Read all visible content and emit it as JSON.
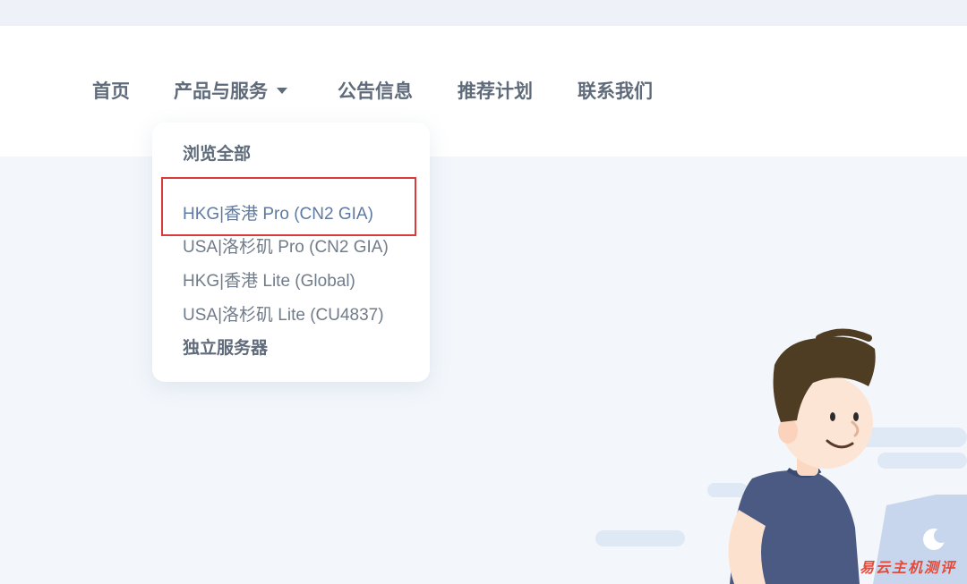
{
  "nav": {
    "items": [
      {
        "label": "首页"
      },
      {
        "label": "产品与服务"
      },
      {
        "label": "公告信息"
      },
      {
        "label": "推荐计划"
      },
      {
        "label": "联系我们"
      }
    ]
  },
  "dropdown": {
    "browse_all": "浏览全部",
    "items": [
      {
        "label": "HKG|香港 Pro (CN2 GIA)"
      },
      {
        "label": "USA|洛杉矶 Pro (CN2 GIA)"
      },
      {
        "label": "HKG|香港 Lite (Global)"
      },
      {
        "label": "USA|洛杉矶 Lite (CU4837)"
      }
    ],
    "dedicated": "独立服务器"
  },
  "watermark": "易云主机测评",
  "colors": {
    "accent_highlight": "#d93a3a",
    "nav_text": "#5f6b7a",
    "hover_text": "#5f7aa0"
  }
}
